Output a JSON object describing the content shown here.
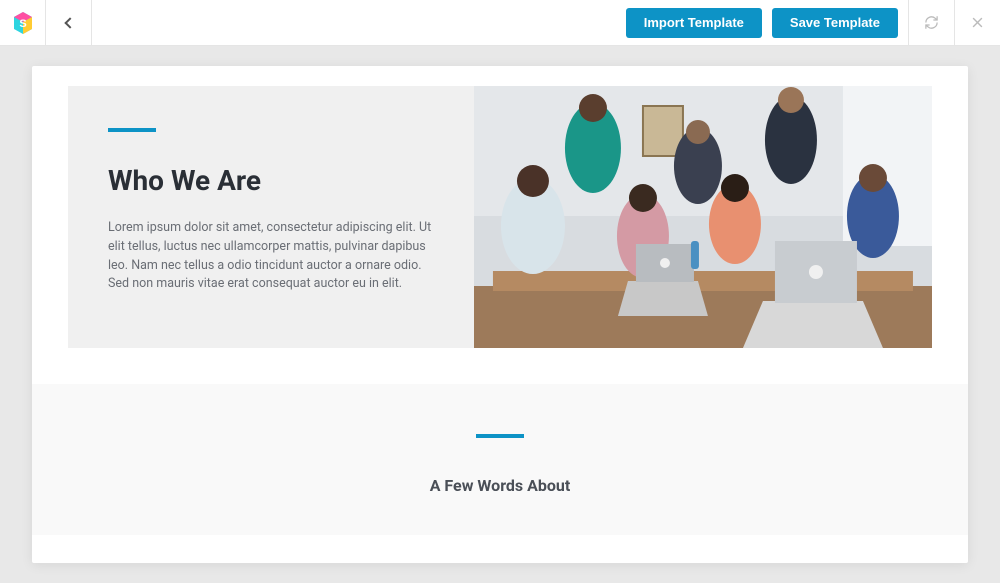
{
  "header": {
    "import_label": "Import Template",
    "save_label": "Save Template"
  },
  "hero": {
    "heading": "Who We Are",
    "body": "Lorem ipsum dolor sit amet, consectetur adipiscing elit. Ut elit tellus, luctus nec ullamcorper mattis, pulvinar dapibus leo. Nam nec tellus a odio tincidunt auctor a ornare odio. Sed non mauris vitae erat consequat auctor eu in elit."
  },
  "second": {
    "heading": "A Few Words About"
  }
}
